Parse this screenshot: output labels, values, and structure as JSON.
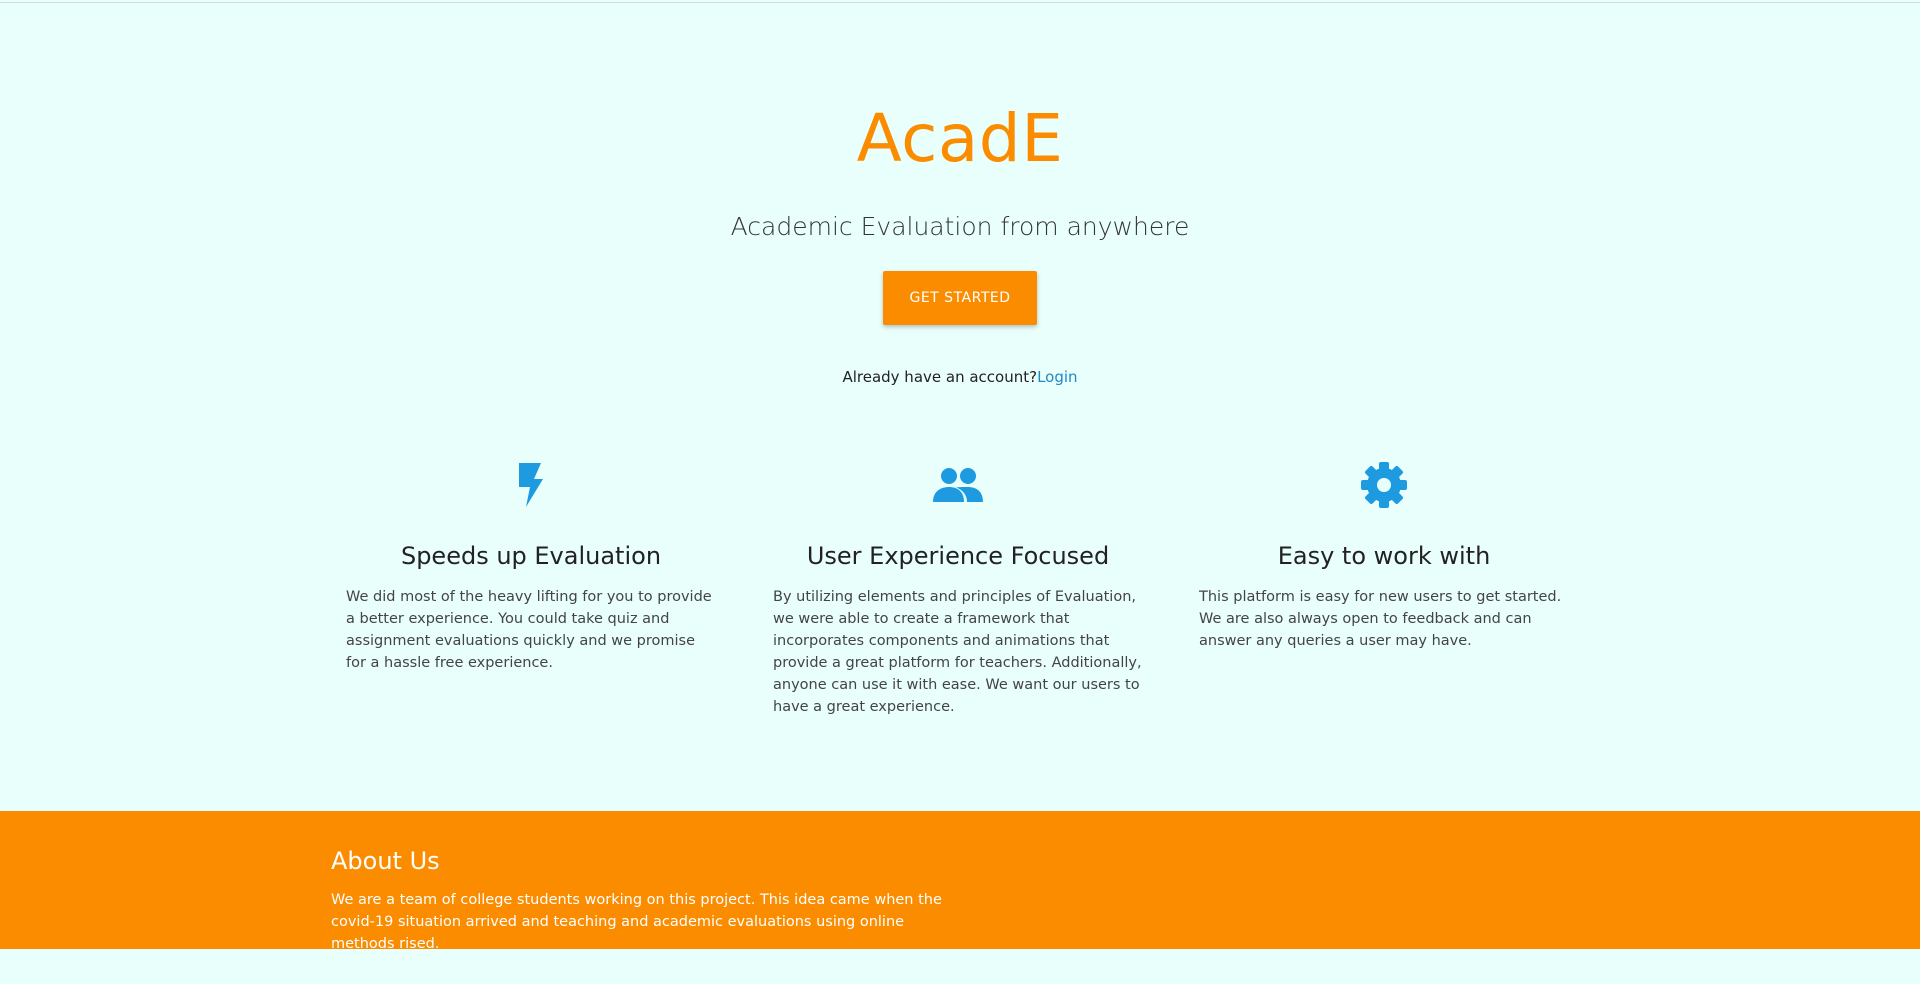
{
  "hero": {
    "brand": "AcadE",
    "tagline": "Academic Evaluation from anywhere",
    "cta_label": "GET STARTED",
    "account_prompt": "Already have an account?",
    "login_label": "Login"
  },
  "features": [
    {
      "icon": "lightning-bolt-icon",
      "title": "Speeds up Evaluation",
      "text": "We did most of the heavy lifting for you to provide a better experience. You could take quiz and assignment evaluations quickly and we promise for a hassle free experience."
    },
    {
      "icon": "group-icon",
      "title": "User Experience Focused",
      "text": "By utilizing elements and principles of Evaluation, we were able to create a framework that incorporates components and animations that provide a great platform for teachers. Additionally, anyone can use it with ease. We want our users to have a great experience."
    },
    {
      "icon": "gear-icon",
      "title": "Easy to work with",
      "text": "This platform is easy for new users to get started. We are also always open to feedback and can answer any queries a user may have."
    }
  ],
  "footer": {
    "title": "About Us",
    "text": "We are a team of college students working on this project. This idea came when the covid-19 situation arrived and teaching and academic evaluations using online methods rised."
  },
  "colors": {
    "accent": "#fb8c00",
    "icon": "#1e9be0",
    "link": "#1e88c8",
    "background": "#e9fffc"
  }
}
